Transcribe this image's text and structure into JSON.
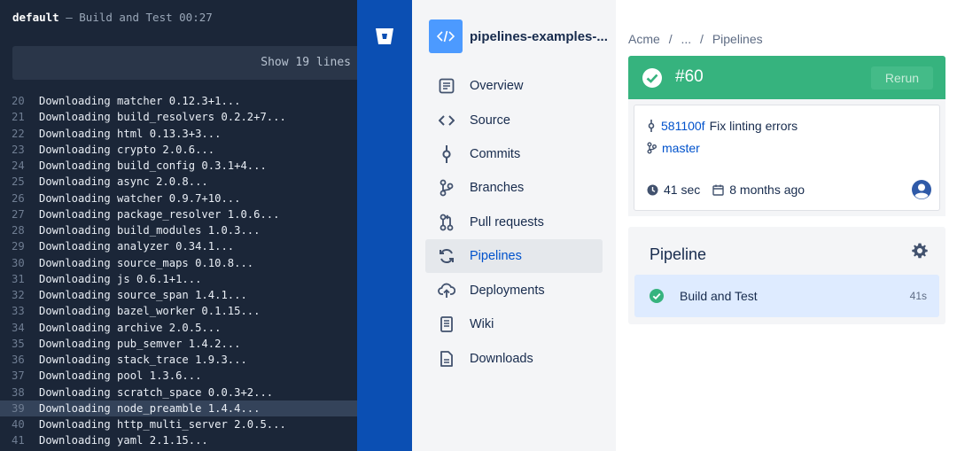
{
  "log": {
    "step_name": "default",
    "header_rest": " — Build and Test 00:27",
    "show_lines_label": "Show 19 lines",
    "lines": [
      {
        "n": "20",
        "text": "Downloading matcher 0.12.3+1..."
      },
      {
        "n": "21",
        "text": "Downloading build_resolvers 0.2.2+7..."
      },
      {
        "n": "22",
        "text": "Downloading html 0.13.3+3..."
      },
      {
        "n": "23",
        "text": "Downloading crypto 2.0.6..."
      },
      {
        "n": "24",
        "text": "Downloading build_config 0.3.1+4..."
      },
      {
        "n": "25",
        "text": "Downloading async 2.0.8..."
      },
      {
        "n": "26",
        "text": "Downloading watcher 0.9.7+10..."
      },
      {
        "n": "27",
        "text": "Downloading package_resolver 1.0.6..."
      },
      {
        "n": "28",
        "text": "Downloading build_modules 1.0.3..."
      },
      {
        "n": "29",
        "text": "Downloading analyzer 0.34.1..."
      },
      {
        "n": "30",
        "text": "Downloading source_maps 0.10.8..."
      },
      {
        "n": "31",
        "text": "Downloading js 0.6.1+1..."
      },
      {
        "n": "32",
        "text": "Downloading source_span 1.4.1..."
      },
      {
        "n": "33",
        "text": "Downloading bazel_worker 0.1.15..."
      },
      {
        "n": "34",
        "text": "Downloading archive 2.0.5..."
      },
      {
        "n": "35",
        "text": "Downloading pub_semver 1.4.2..."
      },
      {
        "n": "36",
        "text": "Downloading stack_trace 1.9.3..."
      },
      {
        "n": "37",
        "text": "Downloading pool 1.3.6..."
      },
      {
        "n": "38",
        "text": "Downloading scratch_space 0.0.3+2..."
      },
      {
        "n": "39",
        "text": "Downloading node_preamble 1.4.4...",
        "highlight": true
      },
      {
        "n": "40",
        "text": "Downloading http_multi_server 2.0.5..."
      },
      {
        "n": "41",
        "text": "Downloading yaml 2.1.15..."
      }
    ]
  },
  "repo": {
    "name": "pipelines-examples-...",
    "avatar_icon": "code-icon"
  },
  "sidebar": {
    "items": [
      {
        "label": "Overview",
        "icon": "overview-icon"
      },
      {
        "label": "Source",
        "icon": "source-code-icon"
      },
      {
        "label": "Commits",
        "icon": "commit-icon"
      },
      {
        "label": "Branches",
        "icon": "branch-icon"
      },
      {
        "label": "Pull requests",
        "icon": "pull-request-icon"
      },
      {
        "label": "Pipelines",
        "icon": "pipelines-icon",
        "active": true
      },
      {
        "label": "Deployments",
        "icon": "deployments-icon"
      },
      {
        "label": "Wiki",
        "icon": "wiki-icon"
      },
      {
        "label": "Downloads",
        "icon": "downloads-icon"
      }
    ]
  },
  "breadcrumb": {
    "items": [
      "Acme",
      "/",
      "...",
      "/",
      "Pipelines"
    ]
  },
  "build": {
    "number": "#60",
    "status": "successful",
    "rerun_label": "Rerun",
    "commit_hash": "581100f",
    "commit_message": "Fix linting errors",
    "branch": "master",
    "duration": "41 sec",
    "age": "8 months ago"
  },
  "pipeline": {
    "title": "Pipeline",
    "steps": [
      {
        "name": "Build and Test",
        "duration": "41s",
        "status": "successful"
      }
    ]
  },
  "colors": {
    "log_bg": "#1b2638",
    "global_nav": "#0b4fb3",
    "success": "#36b37e",
    "link": "#0052cc",
    "selected_step": "#deebff"
  }
}
